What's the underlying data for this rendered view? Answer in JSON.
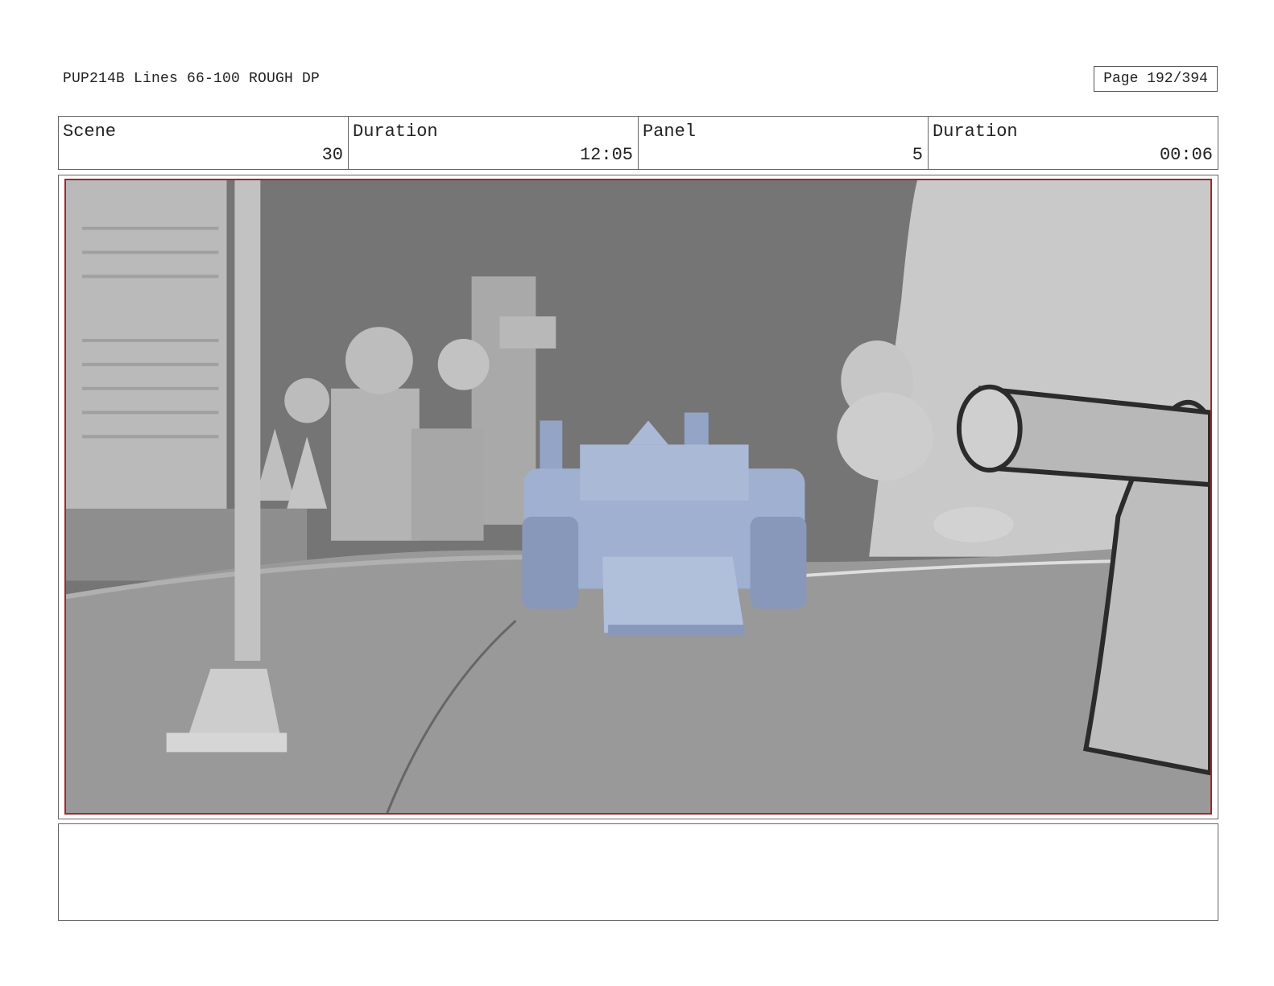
{
  "header": {
    "title": "PUP214B Lines 66-100 ROUGH DP",
    "page": "Page 192/394"
  },
  "info_row": [
    {
      "label": "Scene",
      "value": "30"
    },
    {
      "label": "Duration",
      "value": "12:05"
    },
    {
      "label": "Panel",
      "value": "5"
    },
    {
      "label": "Duration",
      "value": "00:06"
    }
  ],
  "panel": {
    "icons": [
      "tank-vehicle-icon",
      "street-lamp-icon",
      "pipe-icon"
    ],
    "colors": {
      "frame_border": "#a3262b",
      "vehicle": "#9fb0d0",
      "sky": "#7a7a7a"
    }
  },
  "notes": {
    "text": ""
  }
}
